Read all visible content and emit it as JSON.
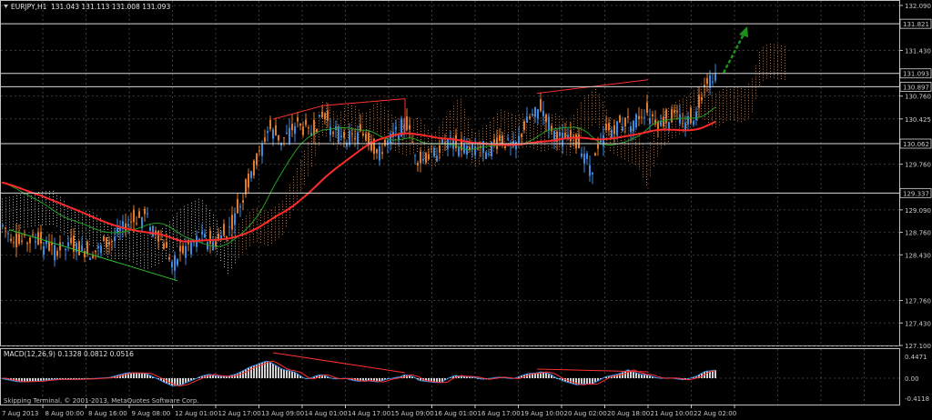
{
  "header": {
    "symbol": "EURJPY,H1",
    "ohlc": "131.043 131.113 131.008 131.093"
  },
  "price_axis": {
    "ticks": [
      "132.090",
      "131.430",
      "130.760",
      "130.425",
      "129.760",
      "129.090",
      "128.760",
      "128.430",
      "127.760",
      "127.430",
      "127.100"
    ],
    "tick_values": [
      132.09,
      131.43,
      130.76,
      130.425,
      129.76,
      129.09,
      128.76,
      128.43,
      127.76,
      127.43,
      127.1
    ]
  },
  "levels": [
    {
      "label": "131.821",
      "value": 131.821
    },
    {
      "label": "131.093",
      "value": 131.093
    },
    {
      "label": "130.897",
      "value": 130.897
    },
    {
      "label": "130.062",
      "value": 130.062
    },
    {
      "label": "129.337",
      "value": 129.337
    }
  ],
  "time_axis": {
    "labels": [
      "7 Aug 2013",
      "8 Aug 00:00",
      "8 Aug 16:00",
      "9 Aug 08:00",
      "12 Aug 01:00",
      "12 Aug 17:00",
      "13 Aug 09:00",
      "14 Aug 01:00",
      "14 Aug 17:00",
      "15 Aug 09:00",
      "16 Aug 01:00",
      "16 Aug 17:00",
      "19 Aug 10:00",
      "20 Aug 02:00",
      "20 Aug 18:00",
      "21 Aug 10:00",
      "22 Aug 02:00"
    ]
  },
  "indicator": {
    "title": "MACD(12,26,9) 0.1328 0.0812 0.0516",
    "ticks": [
      "0.4471",
      "0.00",
      "-0.4118"
    ],
    "tick_values": [
      0.4471,
      0.0,
      -0.4118
    ]
  },
  "copyright": "Skipping Terminal, © 2001-2013, MetaQuotes Software Corp.",
  "colors": {
    "background": "#000000",
    "bull": "#3d8be0",
    "bear": "#e07a2a",
    "ma_slow": "#ff2a2a",
    "ma_fast": "#22a022",
    "cloud_a": "#e8e8e8",
    "cloud_b": "#e0a070",
    "arrow": "#1e8f1e"
  },
  "chart_data": {
    "type": "candlestick",
    "title": "EURJPY,H1",
    "ylim": [
      127.1,
      132.09
    ],
    "series": [
      {
        "name": "EURJPY,H1",
        "approx_path": [
          [
            0,
            128.9
          ],
          [
            20,
            128.6
          ],
          [
            40,
            128.65
          ],
          [
            60,
            128.5
          ],
          [
            80,
            128.55
          ],
          [
            100,
            128.45
          ],
          [
            120,
            128.6
          ],
          [
            140,
            128.9
          ],
          [
            160,
            129.0
          ],
          [
            175,
            128.7
          ],
          [
            190,
            128.3
          ],
          [
            205,
            128.55
          ],
          [
            220,
            128.7
          ],
          [
            235,
            128.6
          ],
          [
            250,
            128.75
          ],
          [
            265,
            129.2
          ],
          [
            280,
            129.7
          ],
          [
            295,
            130.3
          ],
          [
            310,
            130.1
          ],
          [
            325,
            130.35
          ],
          [
            340,
            130.2
          ],
          [
            355,
            130.45
          ],
          [
            370,
            130.25
          ],
          [
            385,
            130.15
          ],
          [
            400,
            130.2
          ],
          [
            415,
            129.9
          ],
          [
            430,
            130.15
          ],
          [
            445,
            130.4
          ],
          [
            460,
            129.8
          ],
          [
            475,
            129.9
          ],
          [
            490,
            130.1
          ],
          [
            505,
            130.0
          ],
          [
            520,
            130.05
          ],
          [
            535,
            130.0
          ],
          [
            550,
            130.1
          ],
          [
            565,
            130.0
          ],
          [
            580,
            130.4
          ],
          [
            595,
            130.6
          ],
          [
            610,
            130.2
          ],
          [
            625,
            130.1
          ],
          [
            640,
            130.0
          ],
          [
            650,
            129.7
          ],
          [
            665,
            130.2
          ],
          [
            680,
            130.35
          ],
          [
            695,
            130.4
          ],
          [
            710,
            130.55
          ],
          [
            725,
            130.35
          ],
          [
            740,
            130.45
          ],
          [
            755,
            130.4
          ],
          [
            765,
            130.5
          ],
          [
            775,
            131.0
          ],
          [
            785,
            131.09
          ]
        ]
      }
    ]
  }
}
